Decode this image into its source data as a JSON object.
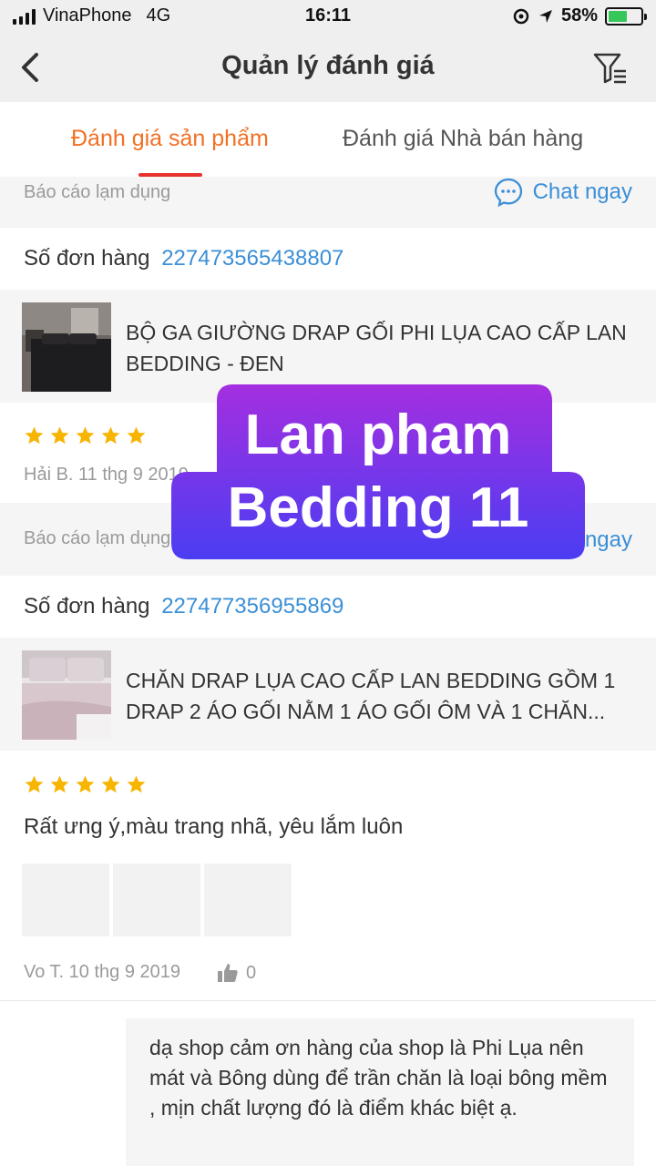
{
  "status_bar": {
    "carrier": "VinaPhone",
    "network": "4G",
    "time": "16:11",
    "battery": "58%",
    "battery_level": 0.58
  },
  "nav": {
    "title": "Quản lý đánh giá",
    "back_icon": "chevron-left-icon",
    "filter_icon": "filter-icon"
  },
  "tabs": [
    {
      "label": "Đánh giá sản phẩm",
      "active": true
    },
    {
      "label": "Đánh giá Nhà bán hàng",
      "active": false
    }
  ],
  "colors": {
    "accent": "#f27023",
    "indicator": "#e8312f",
    "link": "#3b8fd6",
    "star": "#f7b500",
    "overlay_from": "#a42fe0",
    "overlay_to": "#4b3df2"
  },
  "reviews": [
    {
      "report_label": "Báo cáo lạm dụng",
      "chat_label": "Chat ngay",
      "order_label": "Số đơn hàng",
      "order_number": "227473565438807",
      "product_name": "BỘ GA GIƯỜNG DRAP GỐI PHI LỤA CAO CẤP LAN BEDDING - ĐEN",
      "rating": 5,
      "author_date": "Hải B. 11 thg 9 2019"
    },
    {
      "report_label": "Báo cáo lạm dụng",
      "chat_label": "Chat ngay",
      "order_label": "Số đơn hàng",
      "order_number": "227477356955869",
      "product_name": "CHĂN DRAP LỤA CAO CẤP LAN BEDDING GỒM 1 DRAP 2 ÁO GỐI NẰM 1 ÁO GỐI ÔM VÀ 1 CHĂN...",
      "rating": 5,
      "comment": "Rất ưng ý,màu trang nhã, yêu lắm luôn",
      "author_date": "Vo T. 10 thg 9 2019",
      "likes": "0",
      "seller_reply": "dạ shop cảm ơn hàng của shop là Phi Lụa nên mát và Bông dùng để trần chăn là loại bông mềm , mịn chất lượng đó là điểm khác biệt ạ."
    }
  ],
  "overlay": {
    "line1": "Lan pham",
    "line2": "Bedding 11"
  }
}
